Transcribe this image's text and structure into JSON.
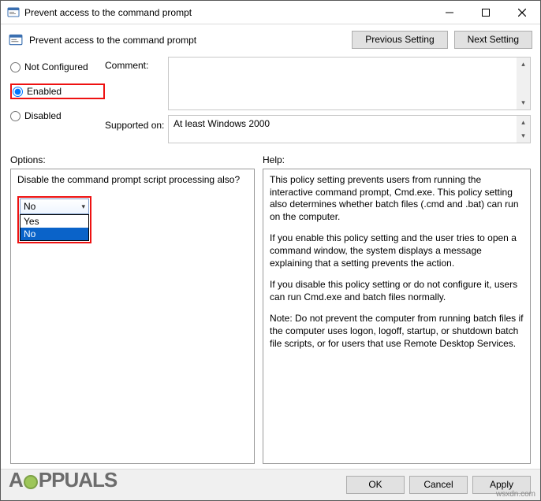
{
  "titlebar": {
    "title": "Prevent access to the command prompt"
  },
  "header": {
    "title": "Prevent access to the command prompt",
    "prev": "Previous Setting",
    "next": "Next Setting"
  },
  "radios": {
    "not_configured": "Not Configured",
    "enabled": "Enabled",
    "disabled": "Disabled",
    "selected": "enabled"
  },
  "labels": {
    "comment": "Comment:",
    "supported": "Supported on:",
    "options": "Options:",
    "help": "Help:"
  },
  "supported": {
    "text": "At least Windows 2000"
  },
  "options": {
    "question": "Disable the command prompt script processing also?",
    "combo": {
      "value": "No",
      "items": [
        "Yes",
        "No"
      ],
      "highlighted": "No"
    }
  },
  "help": {
    "p1": "This policy setting prevents users from running the interactive command prompt, Cmd.exe.  This policy setting also determines whether batch files (.cmd and .bat) can run on the computer.",
    "p2": "If you enable this policy setting and the user tries to open a command window, the system displays a message explaining that a setting prevents the action.",
    "p3": "If you disable this policy setting or do not configure it, users can run Cmd.exe and batch files normally.",
    "p4": "Note: Do not prevent the computer from running batch files if the computer uses logon, logoff, startup, or shutdown batch file scripts, or for users that use Remote Desktop Services."
  },
  "footer": {
    "ok": "OK",
    "cancel": "Cancel",
    "apply": "Apply"
  },
  "watermark": {
    "brand_left": "A",
    "brand_right": "PPUALS",
    "site": "wsxdn.com"
  }
}
